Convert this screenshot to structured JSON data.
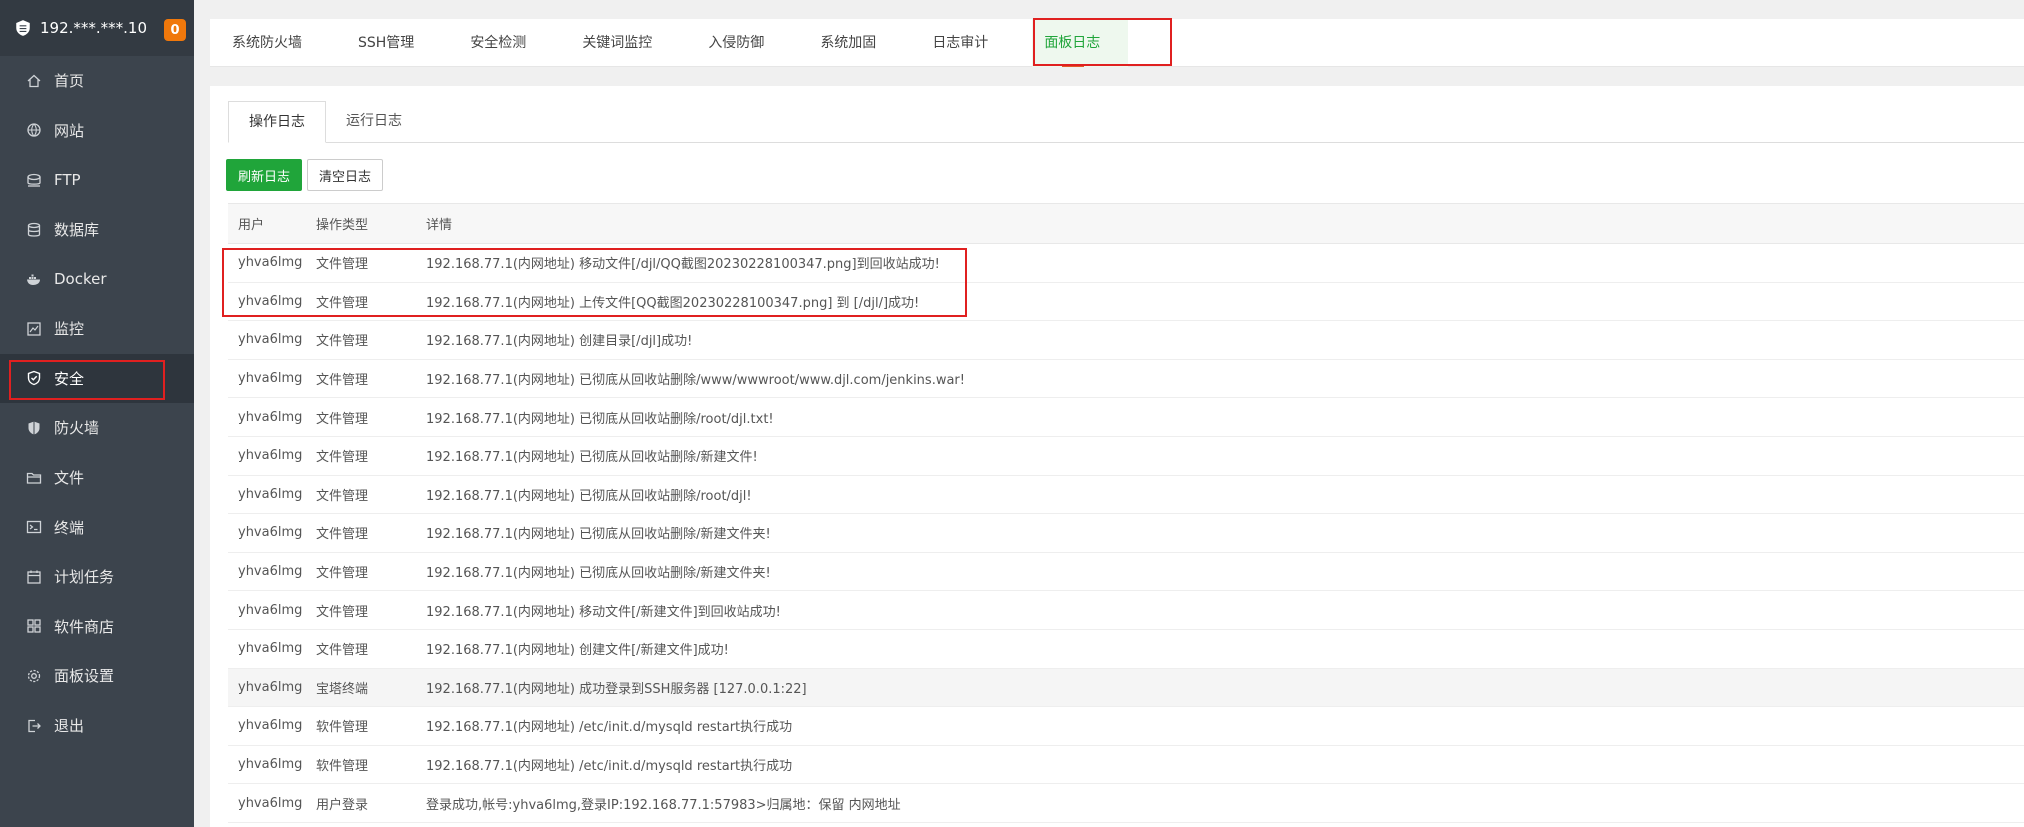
{
  "sidebar": {
    "host": "192.***.***.10",
    "badge": "0",
    "items": [
      {
        "id": "home",
        "label": "首页",
        "icon": "home-icon"
      },
      {
        "id": "site",
        "label": "网站",
        "icon": "globe-icon"
      },
      {
        "id": "ftp",
        "label": "FTP",
        "icon": "ftp-icon"
      },
      {
        "id": "database",
        "label": "数据库",
        "icon": "database-icon"
      },
      {
        "id": "docker",
        "label": "Docker",
        "icon": "docker-icon"
      },
      {
        "id": "monitor",
        "label": "监控",
        "icon": "monitor-icon"
      },
      {
        "id": "security",
        "label": "安全",
        "icon": "shield-icon"
      },
      {
        "id": "firewall",
        "label": "防火墙",
        "icon": "firewall-icon"
      },
      {
        "id": "files",
        "label": "文件",
        "icon": "folder-icon"
      },
      {
        "id": "terminal",
        "label": "终端",
        "icon": "terminal-icon"
      },
      {
        "id": "cron",
        "label": "计划任务",
        "icon": "calendar-icon"
      },
      {
        "id": "store",
        "label": "软件商店",
        "icon": "apps-icon"
      },
      {
        "id": "settings",
        "label": "面板设置",
        "icon": "gear-icon"
      },
      {
        "id": "logout",
        "label": "退出",
        "icon": "logout-icon"
      }
    ]
  },
  "top_tabs": [
    "系统防火墙",
    "SSH管理",
    "安全检测",
    "关键词监控",
    "入侵防御",
    "系统加固",
    "日志审计",
    "面板日志"
  ],
  "sub_tabs": [
    "操作日志",
    "运行日志"
  ],
  "buttons": {
    "refresh": "刷新日志",
    "clear": "清空日志"
  },
  "table": {
    "headers": [
      "用户",
      "操作类型",
      "详情"
    ],
    "rows": [
      [
        "yhva6lmg",
        "文件管理",
        "192.168.77.1(内网地址) 移动文件[/djl/QQ截图20230228100347.png]到回收站成功!"
      ],
      [
        "yhva6lmg",
        "文件管理",
        "192.168.77.1(内网地址) 上传文件[QQ截图20230228100347.png] 到 [/djl/]成功!"
      ],
      [
        "yhva6lmg",
        "文件管理",
        "192.168.77.1(内网地址) 创建目录[/djl]成功!"
      ],
      [
        "yhva6lmg",
        "文件管理",
        "192.168.77.1(内网地址) 已彻底从回收站删除/www/wwwroot/www.djl.com/jenkins.war!"
      ],
      [
        "yhva6lmg",
        "文件管理",
        "192.168.77.1(内网地址) 已彻底从回收站删除/root/djl.txt!"
      ],
      [
        "yhva6lmg",
        "文件管理",
        "192.168.77.1(内网地址) 已彻底从回收站删除/新建文件!"
      ],
      [
        "yhva6lmg",
        "文件管理",
        "192.168.77.1(内网地址) 已彻底从回收站删除/root/djl!"
      ],
      [
        "yhva6lmg",
        "文件管理",
        "192.168.77.1(内网地址) 已彻底从回收站删除/新建文件夹!"
      ],
      [
        "yhva6lmg",
        "文件管理",
        "192.168.77.1(内网地址) 已彻底从回收站删除/新建文件夹!"
      ],
      [
        "yhva6lmg",
        "文件管理",
        "192.168.77.1(内网地址) 移动文件[/新建文件]到回收站成功!"
      ],
      [
        "yhva6lmg",
        "文件管理",
        "192.168.77.1(内网地址) 创建文件[/新建文件]成功!"
      ],
      [
        "yhva6lmg",
        "宝塔终端",
        "192.168.77.1(内网地址) 成功登录到SSH服务器 [127.0.0.1:22]"
      ],
      [
        "yhva6lmg",
        "软件管理",
        "192.168.77.1(内网地址) /etc/init.d/mysqld restart执行成功"
      ],
      [
        "yhva6lmg",
        "软件管理",
        "192.168.77.1(内网地址) /etc/init.d/mysqld restart执行成功"
      ],
      [
        "yhva6lmg",
        "用户登录",
        "登录成功,帐号:yhva6lmg,登录IP:192.168.77.1:57983>归属地：保留 内网地址"
      ]
    ]
  }
}
